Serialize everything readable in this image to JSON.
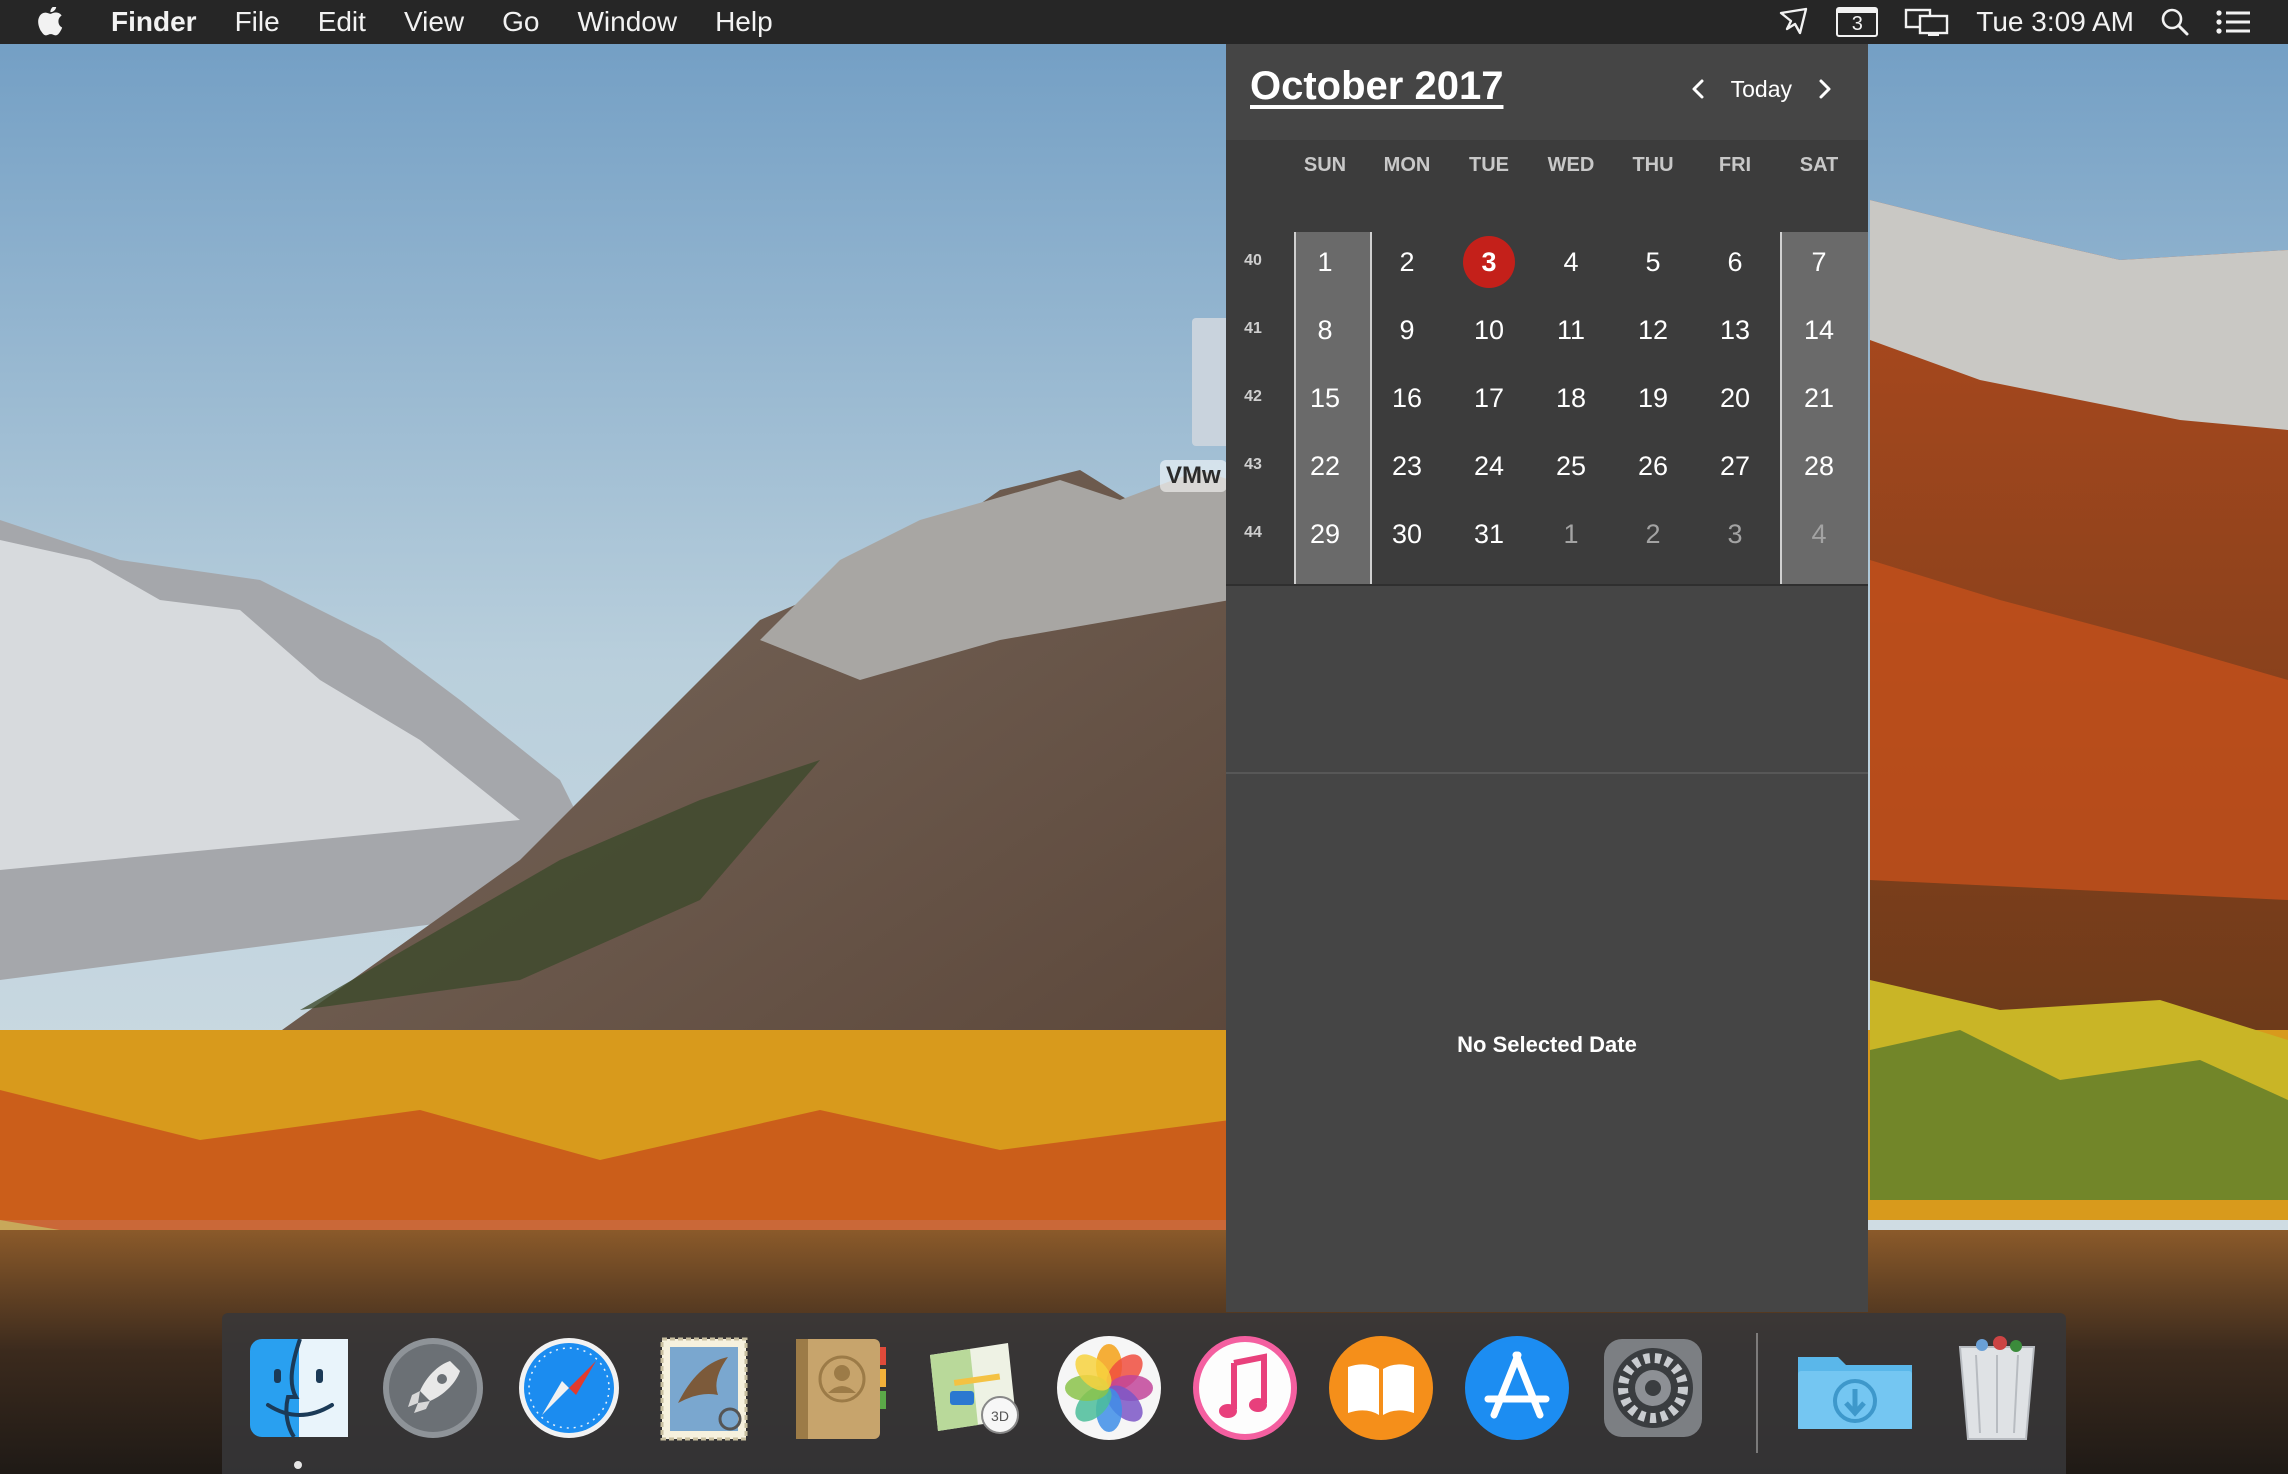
{
  "menubar": {
    "app_name": "Finder",
    "menus": [
      "File",
      "Edit",
      "View",
      "Go",
      "Window",
      "Help"
    ],
    "calendar_badge": "3",
    "clock": "Tue 3:09 AM"
  },
  "desktop": {
    "file_label": "VMw"
  },
  "calendar": {
    "month_title": "October 2017",
    "today_label": "Today",
    "weekdays": [
      "SUN",
      "MON",
      "TUE",
      "WED",
      "THU",
      "FRI",
      "SAT"
    ],
    "week_numbers": [
      "40",
      "41",
      "42",
      "43",
      "44"
    ],
    "weeks": [
      [
        "1",
        "2",
        "3",
        "4",
        "5",
        "6",
        "7"
      ],
      [
        "8",
        "9",
        "10",
        "11",
        "12",
        "13",
        "14"
      ],
      [
        "15",
        "16",
        "17",
        "18",
        "19",
        "20",
        "21"
      ],
      [
        "22",
        "23",
        "24",
        "25",
        "26",
        "27",
        "28"
      ],
      [
        "29",
        "30",
        "31",
        "1",
        "2",
        "3",
        "4"
      ]
    ],
    "today": "3",
    "other_month_days_in_last_week": 4,
    "no_selection_text": "No Selected Date",
    "today_color": "#c4201a"
  },
  "dock": {
    "items": [
      "Finder",
      "Launchpad",
      "Safari",
      "Mail",
      "Contacts",
      "Maps",
      "Photos",
      "iTunes",
      "iBooks",
      "App Store",
      "System Preferences",
      "Downloads",
      "Trash"
    ]
  }
}
